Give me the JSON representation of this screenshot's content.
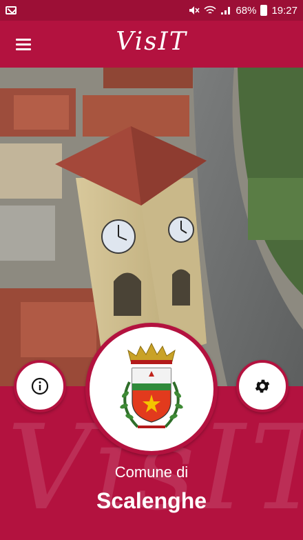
{
  "status_bar": {
    "battery": "68%",
    "time": "19:27"
  },
  "app_bar": {
    "logo": "VisIT",
    "menu_icon": "hamburger-menu-icon"
  },
  "hero": {
    "image": "aerial view of clock tower"
  },
  "actions": {
    "info_icon": "info-icon",
    "settings_icon": "gear-icon"
  },
  "crest": {
    "icon": "municipal-coat-of-arms"
  },
  "panel": {
    "watermark": "VisIT",
    "subtitle": "Comune di",
    "title": "Scalenghe"
  },
  "colors": {
    "brand": "#b3123f",
    "status_bar": "#9c0f36"
  }
}
